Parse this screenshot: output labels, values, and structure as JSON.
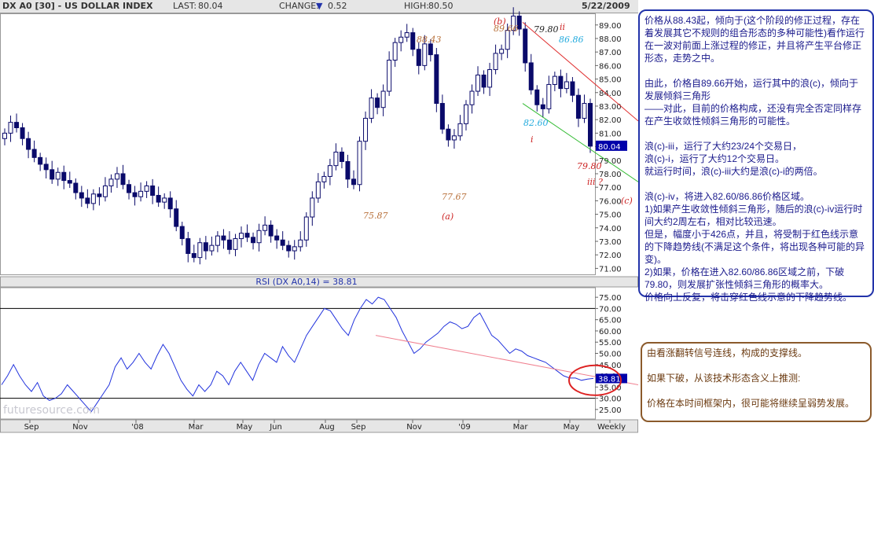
{
  "header": {
    "symbol": "DX A0 [30] - US DOLLAR INDEX",
    "last_label": "LAST:",
    "last_value": "80.04",
    "change_label": "CHANGE:",
    "change_value": "0.52",
    "high_label": "HIGH:",
    "high_value": "80.50",
    "date": "5/22/2009"
  },
  "colors": {
    "candle": "#0a0a6a",
    "rsi_line": "#2233dd",
    "red_trend": "#e03030",
    "green_trend": "#33bb33",
    "pink_line": "#f08090",
    "last_box": "#0000aa",
    "wave_label_red": "#cc2222",
    "wave_label_brown": "#b8703a",
    "wave_label_blue": "#22aadd",
    "ellipse": "#dd2222"
  },
  "price_axis": {
    "ticks": [
      "89.00",
      "88.00",
      "87.00",
      "86.00",
      "85.00",
      "84.00",
      "83.00",
      "82.00",
      "81.00",
      "80.00",
      "79.00",
      "78.00",
      "77.00",
      "76.00",
      "75.00",
      "74.00",
      "73.00",
      "72.00",
      "71.00"
    ],
    "range": [
      70.5,
      89.8
    ]
  },
  "rsi_panel": {
    "title": "RSI (DX A0,14) = 38.81",
    "ticks": [
      "75.00",
      "70.00",
      "65.00",
      "60.00",
      "55.00",
      "50.00",
      "45.00",
      "40.00",
      "35.00",
      "30.00",
      "25.00"
    ],
    "value": "38.81",
    "watermark": "futuresource.com"
  },
  "time_axis": [
    "Sep",
    "Nov",
    "'08",
    "Mar",
    "May",
    "Jun",
    "Aug",
    "Sep",
    "Nov",
    "'09",
    "Mar",
    "May",
    "Weekly"
  ],
  "price_tags": {
    "last": "80.04"
  },
  "chart_data": {
    "type": "candlestick",
    "weekly_close_approx": [
      81.0,
      81.8,
      81.4,
      80.6,
      79.8,
      79.2,
      78.7,
      78.3,
      77.6,
      78.1,
      77.5,
      77.3,
      76.6,
      76.2,
      75.8,
      76.5,
      76.3,
      77.1,
      77.6,
      78.0,
      77.2,
      76.6,
      76.3,
      76.7,
      77.1,
      76.4,
      75.9,
      76.2,
      75.4,
      74.1,
      73.2,
      72.1,
      71.8,
      72.9,
      72.3,
      72.7,
      73.4,
      73.1,
      72.4,
      73.2,
      73.6,
      73.3,
      72.9,
      73.8,
      74.2,
      73.4,
      73.1,
      72.7,
      72.3,
      72.6,
      73.1,
      74.8,
      76.2,
      77.4,
      77.8,
      78.6,
      79.6,
      78.9,
      77.6,
      77.2,
      80.4,
      82.1,
      83.6,
      82.9,
      84.1,
      86.4,
      87.7,
      88.1,
      88.43,
      87.2,
      86.0,
      87.6,
      86.8,
      83.2,
      81.3,
      80.5,
      80.8,
      81.7,
      83.1,
      84.1,
      85.3,
      84.4,
      85.7,
      86.9,
      87.2,
      88.6,
      89.66,
      88.7,
      86.2,
      84.2,
      83.1,
      82.8,
      84.6,
      85.2,
      84.3,
      84.8,
      83.8,
      82.1,
      83.2,
      80.04
    ],
    "annotations": [
      "88.43",
      "89.66",
      "79.80",
      "(b)",
      "ii",
      "86.86",
      "82.60",
      "i",
      "79.80",
      "iii ?",
      "(c)",
      "77.67",
      "75.87",
      "(a)"
    ],
    "rsi_close_approx": [
      36,
      40,
      45,
      40,
      36,
      33,
      37,
      31,
      29,
      30,
      32,
      36,
      33,
      30,
      27,
      24,
      28,
      32,
      36,
      44,
      48,
      43,
      46,
      50,
      46,
      43,
      49,
      54,
      50,
      44,
      38,
      34,
      31,
      36,
      33,
      36,
      42,
      40,
      36,
      42,
      46,
      42,
      38,
      45,
      50,
      48,
      46,
      53,
      49,
      46,
      52,
      58,
      62,
      66,
      70,
      69,
      65,
      61,
      58,
      65,
      70,
      74,
      72,
      75,
      74,
      70,
      66,
      60,
      55,
      50,
      52,
      55,
      57,
      59,
      62,
      64,
      63,
      61,
      62,
      66,
      68,
      63,
      58,
      56,
      53,
      50,
      52,
      51,
      49,
      48,
      47,
      46,
      44,
      42,
      40,
      39,
      39,
      38,
      38.5,
      38.81
    ],
    "xlabel": "",
    "ylabel": ""
  },
  "notes": {
    "box1": [
      "价格从88.43起，倾向于(这个阶段的修正过程，存在着发展其它不规则的组合形态的多种可能性)看作运行在一波对前面上涨过程的修正，并且将产生平台修正形态，走势之中。",
      "",
      "由此，价格自89.66开始，运行其中的浪(c)，倾向于发展倾斜三角形",
      "——对此，目前的价格构成，还没有完全否定同样存在产生收敛性倾斜三角形的可能性。",
      "",
      "浪(c)-iii，运行了大约23/24个交易日，",
      "浪(c)-i，运行了大约12个交易日。",
      "就运行时间，浪(c)-iii大约是浪(c)-i的两倍。",
      "",
      "浪(c)-iv，将进入82.60/86.86价格区域。",
      "1)如果产生收敛性倾斜三角形，随后的浪(c)-iv运行时间大约2周左右，相对比较迅速。",
      "但是，幅度小于426点，并且，将受制于红色线示意的下降趋势线(不满足这个条件，将出现各种可能的异变)。",
      "2)如果，价格在进入82.60/86.86区域之前，下破79.80，则发展扩张性倾斜三角形的概率大。",
      "价格向上反复，将击穿红色线示意的下降趋势线。"
    ],
    "box2": [
      "由看涨翻转信号连线，构成的支撑线。",
      "",
      "如果下破，从该技术形态含义上推测:",
      "",
      "价格在本时间框架内，很可能将继续呈弱势发展。"
    ]
  }
}
